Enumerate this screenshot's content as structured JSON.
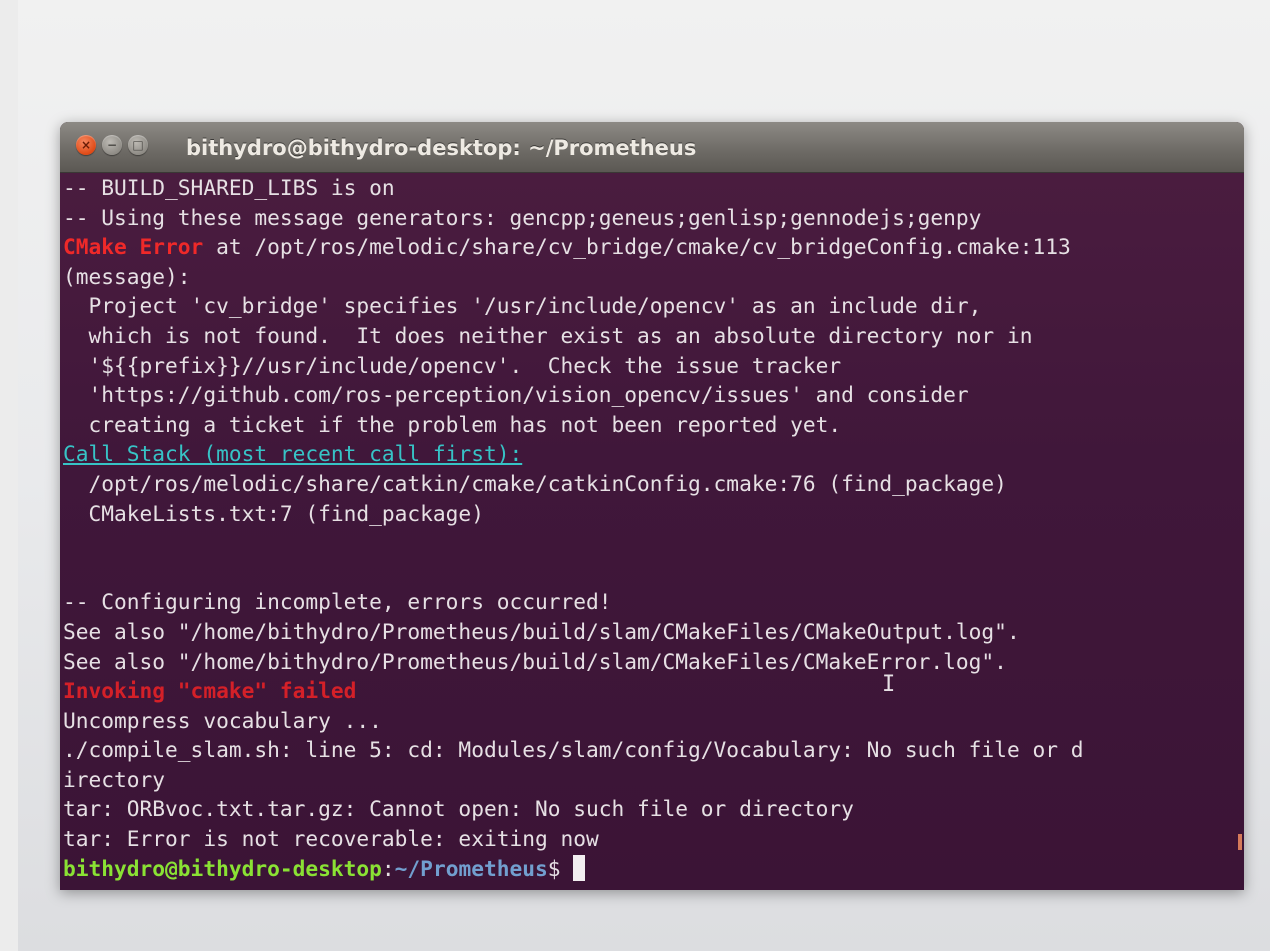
{
  "window": {
    "title": "bithydro@bithydro-desktop: ~/Prometheus",
    "buttons": {
      "close": "×",
      "minimize": "−",
      "maximize": "□"
    }
  },
  "terminal": {
    "lines": [
      {
        "segments": [
          {
            "text": "-- BUILD_SHARED_LIBS is on",
            "style": "normal"
          }
        ]
      },
      {
        "segments": [
          {
            "text": "-- Using these message generators: gencpp;geneus;genlisp;gennodejs;genpy",
            "style": "normal"
          }
        ]
      },
      {
        "segments": [
          {
            "text": "CMake Error",
            "style": "red"
          },
          {
            "text": " at /opt/ros/melodic/share/cv_bridge/cmake/cv_bridgeConfig.cmake:113",
            "style": "normal"
          }
        ]
      },
      {
        "segments": [
          {
            "text": "(message):",
            "style": "normal"
          }
        ]
      },
      {
        "segments": [
          {
            "text": "  Project 'cv_bridge' specifies '/usr/include/opencv' as an include dir,",
            "style": "normal"
          }
        ]
      },
      {
        "segments": [
          {
            "text": "  which is not found.  It does neither exist as an absolute directory nor in",
            "style": "normal"
          }
        ]
      },
      {
        "segments": [
          {
            "text": "  '${{prefix}}//usr/include/opencv'.  Check the issue tracker",
            "style": "normal"
          }
        ]
      },
      {
        "segments": [
          {
            "text": "  'https://github.com/ros-perception/vision_opencv/issues' and consider",
            "style": "normal"
          }
        ]
      },
      {
        "segments": [
          {
            "text": "  creating a ticket if the problem has not been reported yet.",
            "style": "normal"
          }
        ]
      },
      {
        "segments": [
          {
            "text": "Call Stack (most recent call first):",
            "style": "cyan-link"
          }
        ]
      },
      {
        "segments": [
          {
            "text": "  /opt/ros/melodic/share/catkin/cmake/catkinConfig.cmake:76 (find_package)",
            "style": "normal"
          }
        ]
      },
      {
        "segments": [
          {
            "text": "  CMakeLists.txt:7 (find_package)",
            "style": "normal"
          }
        ]
      },
      {
        "segments": [
          {
            "text": "",
            "style": "normal"
          }
        ]
      },
      {
        "segments": [
          {
            "text": "",
            "style": "normal"
          }
        ]
      },
      {
        "segments": [
          {
            "text": "-- Configuring incomplete, errors occurred!",
            "style": "normal"
          }
        ]
      },
      {
        "segments": [
          {
            "text": "See also \"/home/bithydro/Prometheus/build/slam/CMakeFiles/CMakeOutput.log\".",
            "style": "normal"
          }
        ]
      },
      {
        "segments": [
          {
            "text": "See also \"/home/bithydro/Prometheus/build/slam/CMakeFiles/CMakeError.log\".",
            "style": "normal"
          }
        ]
      },
      {
        "segments": [
          {
            "text": "Invoking \"cmake\" failed",
            "style": "red-bold"
          }
        ]
      },
      {
        "segments": [
          {
            "text": "Uncompress vocabulary ...",
            "style": "normal"
          }
        ]
      },
      {
        "segments": [
          {
            "text": "./compile_slam.sh: line 5: cd: Modules/slam/config/Vocabulary: No such file or d",
            "style": "normal"
          }
        ]
      },
      {
        "segments": [
          {
            "text": "irectory",
            "style": "normal"
          }
        ]
      },
      {
        "segments": [
          {
            "text": "tar: ORBvoc.txt.tar.gz: Cannot open: No such file or directory",
            "style": "normal"
          }
        ]
      },
      {
        "segments": [
          {
            "text": "tar: Error is not recoverable: exiting now",
            "style": "normal"
          }
        ]
      }
    ],
    "prompt": {
      "user_host": "bithydro@bithydro-desktop",
      "separator": ":",
      "path": "~/Prometheus",
      "symbol": "$ "
    }
  },
  "colors": {
    "terminal_bg": "#3b1436",
    "error_red": "#ef2929",
    "link_cyan": "#37c3c6",
    "prompt_green": "#8ae234",
    "prompt_blue": "#729fcf",
    "close_button": "#df4a16"
  }
}
